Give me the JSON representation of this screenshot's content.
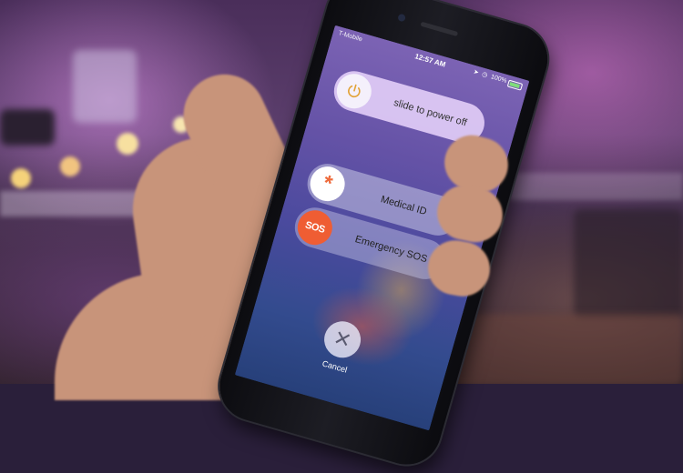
{
  "status_bar": {
    "carrier": "T-Mobile",
    "time": "12:57 AM",
    "battery": "100%"
  },
  "power_slider": {
    "label": "slide to power off",
    "icon": "power-icon"
  },
  "medical_slider": {
    "label": "Medical ID",
    "icon": "asterisk-icon"
  },
  "sos_slider": {
    "label": "Emergency SOS",
    "badge": "SOS"
  },
  "cancel": {
    "label": "Cancel",
    "icon": "close-icon"
  },
  "colors": {
    "power_icon": "#e2a338",
    "medical_accent": "#ee6a3b",
    "sos_badge": "#ef5d33"
  }
}
